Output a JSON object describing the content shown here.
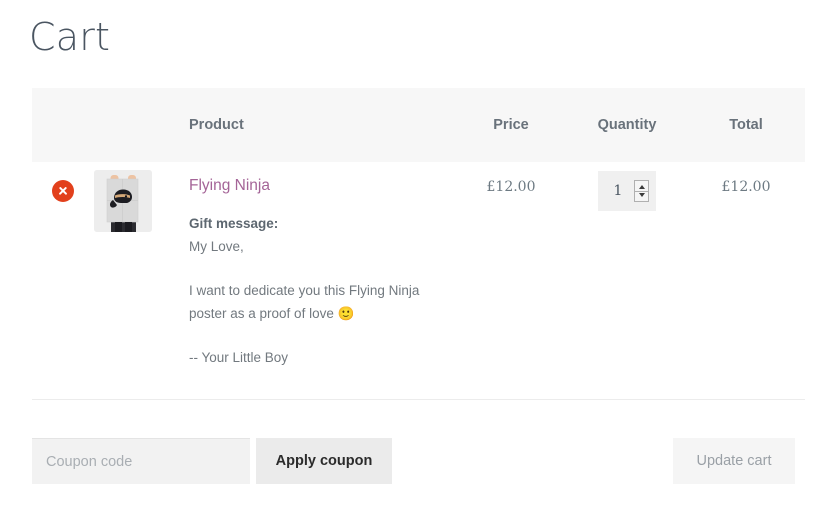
{
  "page": {
    "title": "Cart"
  },
  "table": {
    "headers": {
      "remove": "",
      "thumbnail": "",
      "product": "Product",
      "price": "Price",
      "quantity": "Quantity",
      "total": "Total"
    },
    "rows": [
      {
        "remove_icon": "remove-circle-icon",
        "thumbnail_icon": "product-thumbnail-flying-ninja-poster",
        "product_name": "Flying Ninja",
        "gift_label": "Gift message:",
        "gift_lines": [
          "My Love,",
          "",
          "I want to dedicate you this Flying Ninja",
          "poster as a proof of love 🙂",
          "",
          "-- Your Little Boy"
        ],
        "price": "£12.00",
        "quantity": "1",
        "total": "£12.00"
      }
    ]
  },
  "actions": {
    "coupon_placeholder": "Coupon code",
    "coupon_value": "",
    "apply_coupon_label": "Apply coupon",
    "update_cart_label": "Update cart"
  },
  "colors": {
    "remove_button": "#e2401c",
    "product_link": "#a46497",
    "header_background": "#f7f7f7",
    "text": "#6d7a83",
    "title": "#4a5561"
  }
}
